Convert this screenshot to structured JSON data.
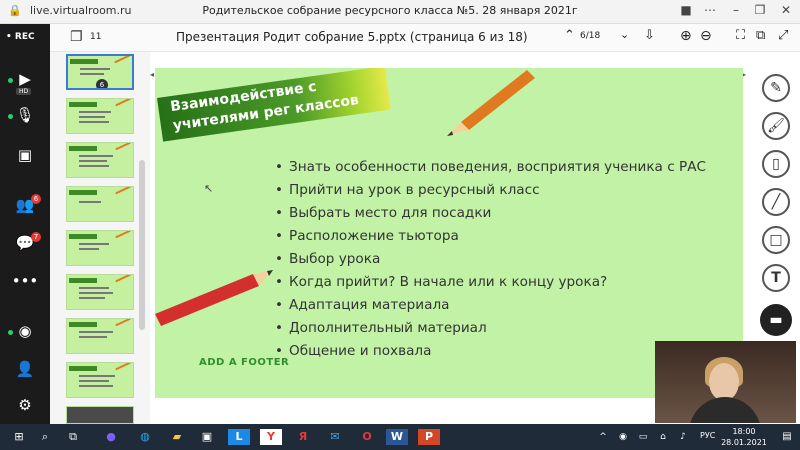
{
  "browser": {
    "url": "live.virtualroom.ru",
    "title": "Родительское собрание ресурсного класса №5. 28 января 2021г"
  },
  "left_sidebar": {
    "rec_label": "• REC",
    "camera_badge": "HD",
    "participants_badge": "6",
    "chat_badge": "7"
  },
  "presentation": {
    "slides_count": "11",
    "title": "Презентация Родит собрание 5.pptx (страница 6 из 18)",
    "page_indicator": "6/18",
    "current_thumb_number": "6"
  },
  "slide": {
    "banner_title": "Взаимодействие с учителями рег классов",
    "bullets": [
      "Знать особенности поведения, восприятия ученика с РАС",
      "Прийти на урок в ресурсный  класс",
      "Выбрать место для посадки",
      "Расположение тьютора",
      "Выбор урока",
      "Когда прийти? В начале или к концу урока?",
      "Адаптация материала",
      "Дополнительный материал",
      "Общение и похвала"
    ],
    "footer": "ADD A FOOTER"
  },
  "taskbar": {
    "lang": "РУС",
    "time": "18:00",
    "date": "28.01.2021"
  },
  "colors": {
    "slide_bg": "#c2f2a6",
    "banner_dark": "#267017",
    "pencil_orange": "#e07a20",
    "pencil_red": "#d32f2f",
    "rec_red": "#e53935"
  }
}
